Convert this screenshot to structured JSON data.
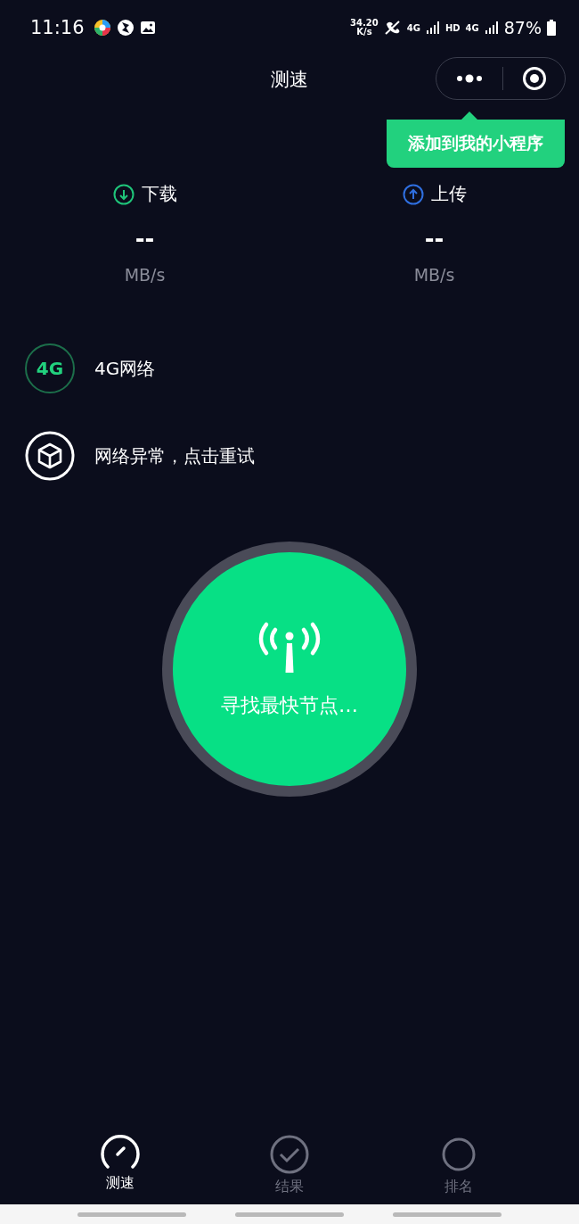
{
  "status_bar": {
    "time": "11:16",
    "speed_value": "34.20",
    "speed_unit": "K/s",
    "network_1": "4G",
    "hd": "HD",
    "network_2": "4G",
    "battery": "87%"
  },
  "nav": {
    "title": "测速"
  },
  "tooltip": {
    "text": "添加到我的小程序"
  },
  "speeds": [
    {
      "kind": "download",
      "label": "下载",
      "value": "--",
      "unit": "MB/s"
    },
    {
      "kind": "upload",
      "label": "上传",
      "value": "--",
      "unit": "MB/s"
    }
  ],
  "info_rows": [
    {
      "kind": "network",
      "badge": "4G",
      "text": "4G网络"
    },
    {
      "kind": "error",
      "text": "网络异常，点击重试"
    }
  ],
  "start_button": {
    "text": "寻找最快节点…"
  },
  "tabs": [
    {
      "kind": "speed",
      "label": "测速",
      "selected": true
    },
    {
      "kind": "result",
      "label": "结果",
      "selected": false
    },
    {
      "kind": "rank",
      "label": "排名",
      "selected": false
    }
  ]
}
